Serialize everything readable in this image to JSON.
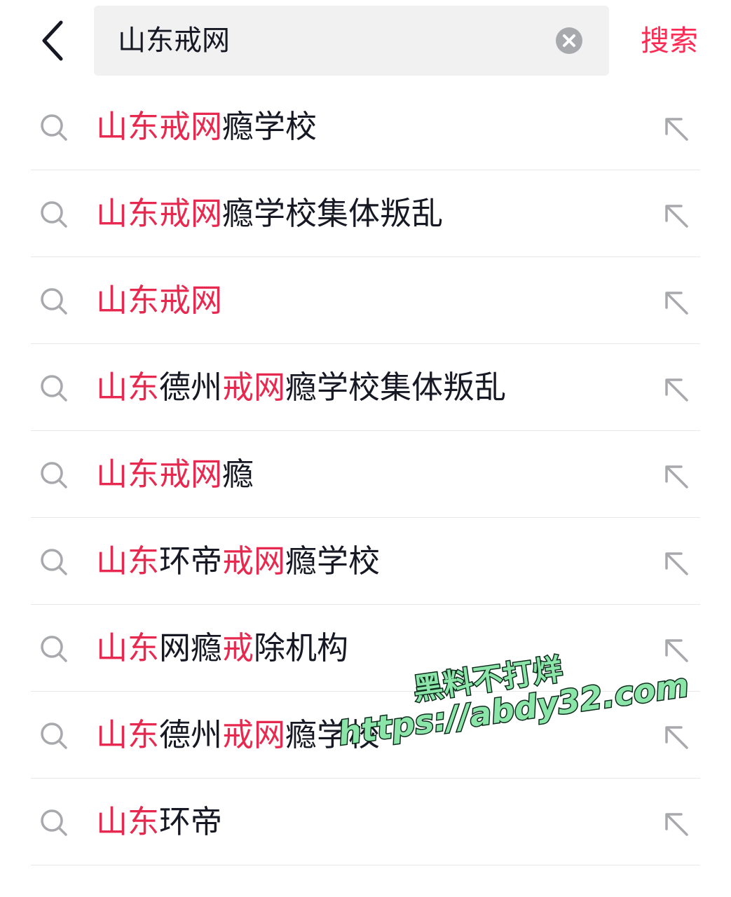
{
  "theme": {
    "accent": "#fe2c55",
    "highlight": "#e8294f",
    "text": "#161823",
    "icon_gray": "#a8a9ad",
    "search_bg": "#f1f1f2"
  },
  "header": {
    "back_icon": "chevron-left-icon",
    "search_value": "山东戒网",
    "clear_icon": "clear-circle-icon",
    "search_button": "搜索"
  },
  "suggestions": [
    {
      "parts": [
        {
          "t": "山东戒网",
          "h": true
        },
        {
          "t": "瘾学校",
          "h": false
        }
      ]
    },
    {
      "parts": [
        {
          "t": "山东戒网",
          "h": true
        },
        {
          "t": "瘾学校集体叛乱",
          "h": false
        }
      ]
    },
    {
      "parts": [
        {
          "t": "山东戒网",
          "h": true
        }
      ]
    },
    {
      "parts": [
        {
          "t": "山东",
          "h": true
        },
        {
          "t": "德州",
          "h": false
        },
        {
          "t": "戒网",
          "h": true
        },
        {
          "t": "瘾学校集体叛乱",
          "h": false
        }
      ]
    },
    {
      "parts": [
        {
          "t": "山东戒网",
          "h": true
        },
        {
          "t": "瘾",
          "h": false
        }
      ]
    },
    {
      "parts": [
        {
          "t": "山东",
          "h": true
        },
        {
          "t": "环帝",
          "h": false
        },
        {
          "t": "戒网",
          "h": true
        },
        {
          "t": "瘾学校",
          "h": false
        }
      ]
    },
    {
      "parts": [
        {
          "t": "山东",
          "h": true
        },
        {
          "t": "网瘾",
          "h": false
        },
        {
          "t": "戒",
          "h": true
        },
        {
          "t": "除机构",
          "h": false
        }
      ]
    },
    {
      "parts": [
        {
          "t": "山东",
          "h": true
        },
        {
          "t": "德州",
          "h": false
        },
        {
          "t": "戒网",
          "h": true
        },
        {
          "t": "瘾学校",
          "h": false
        }
      ]
    },
    {
      "parts": [
        {
          "t": "山东",
          "h": true
        },
        {
          "t": "环帝",
          "h": false
        }
      ]
    }
  ],
  "suggestion_icons": {
    "leading": "search-icon",
    "trailing": "arrow-up-left-icon"
  },
  "watermark": {
    "line1": "黑料不打烊",
    "line2": "https://abdy32.com"
  }
}
